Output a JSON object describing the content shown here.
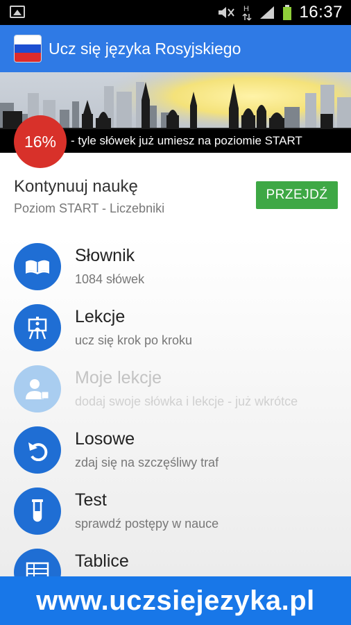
{
  "status_bar": {
    "time": "16:37",
    "icons": [
      "gallery-icon",
      "mute-icon",
      "network-h-icon",
      "signal-icon",
      "battery-icon"
    ],
    "network_label": "H"
  },
  "app_bar": {
    "title": "Ucz się języka Rosyjskiego",
    "flag_colors": [
      "#ffffff",
      "#1c4fd1",
      "#dd2b2b"
    ]
  },
  "banner": {
    "percent": "16%",
    "progress": 0.16,
    "text": "- tyle słówek już umiesz na poziomie START"
  },
  "continue": {
    "title": "Kontynuuj naukę",
    "subtitle": "Poziom START - Liczebniki",
    "button_label": "PRZEJDŹ"
  },
  "menu": {
    "items": [
      {
        "label": "Słownik",
        "sub": "1084 słówek",
        "icon": "book-icon",
        "enabled": true
      },
      {
        "label": "Lekcje",
        "sub": "ucz się krok po kroku",
        "icon": "easel-icon",
        "enabled": true
      },
      {
        "label": "Moje lekcje",
        "sub": "dodaj swoje słówka i lekcje - już wkrótce",
        "icon": "person-add-icon",
        "enabled": false
      },
      {
        "label": "Losowe",
        "sub": "zdaj się na szczęśliwy traf",
        "icon": "undo-arrow-icon",
        "enabled": true
      },
      {
        "label": "Test",
        "sub": "sprawdź postępy w nauce",
        "icon": "test-tube-icon",
        "enabled": true
      },
      {
        "label": "Tablice",
        "sub": "",
        "icon": "table-icon",
        "enabled": true
      }
    ]
  },
  "footer": {
    "url": "www.uczsiejezyka.pl"
  },
  "colors": {
    "primary": "#2f7ae5",
    "icon_circle": "#1f6ed4",
    "icon_circle_disabled": "#a9cdf0",
    "progress_badge": "#d8312a",
    "go_button": "#3ea845",
    "footer": "#1877e8"
  }
}
